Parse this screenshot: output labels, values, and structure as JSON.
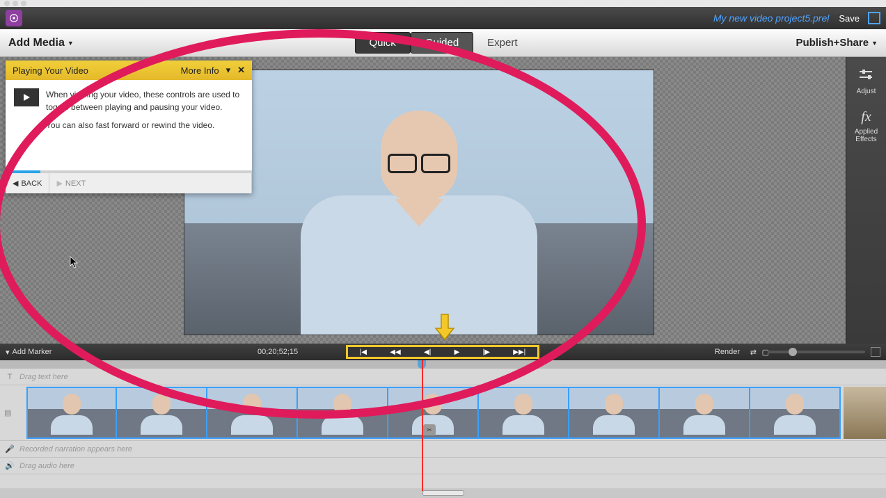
{
  "project_name": "My new video project5.prel",
  "save_label": "Save",
  "add_media_label": "Add Media",
  "publish_label": "Publish+Share",
  "modes": {
    "quick": "Quick",
    "guided": "Guided",
    "expert": "Expert"
  },
  "right_panel": {
    "adjust": "Adjust",
    "applied_effects": "Applied\nEffects"
  },
  "help": {
    "title": "Playing Your Video",
    "more_info": "More Info",
    "body_line1": "When viewing your video, these controls are used to toggle between playing and pausing your video.",
    "body_line2": "You can also fast forward or rewind the video.",
    "back": "BACK",
    "next": "NEXT"
  },
  "controls": {
    "add_marker": "Add Marker",
    "timecode": "00;20;52;15",
    "render": "Render"
  },
  "tracks": {
    "text": "Drag text here",
    "narration": "Recorded narration appears here",
    "audio": "Drag audio here"
  }
}
